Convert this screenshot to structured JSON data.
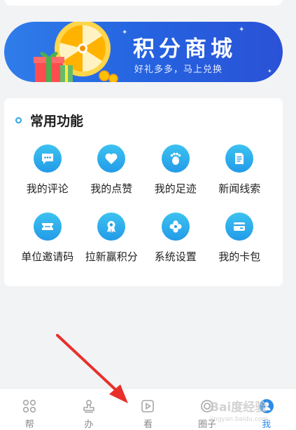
{
  "banner": {
    "title": "积分商城",
    "subtitle": "好礼多多，马上兑换"
  },
  "functions": {
    "title": "常用功能",
    "rows": [
      [
        {
          "label": "我的评论",
          "icon": "comment-icon"
        },
        {
          "label": "我的点赞",
          "icon": "heart-icon"
        },
        {
          "label": "我的足迹",
          "icon": "footprint-icon"
        },
        {
          "label": "新闻线索",
          "icon": "document-icon"
        }
      ],
      [
        {
          "label": "单位邀请码",
          "icon": "ticket-icon"
        },
        {
          "label": "拉新赢积分",
          "icon": "award-icon"
        },
        {
          "label": "系统设置",
          "icon": "settings-icon"
        },
        {
          "label": "我的卡包",
          "icon": "card-wallet-icon"
        }
      ]
    ]
  },
  "bottom_nav": [
    {
      "label": "帮",
      "icon": "grid-icon",
      "active": false
    },
    {
      "label": "办",
      "icon": "stamp-icon",
      "active": false
    },
    {
      "label": "看",
      "icon": "play-icon",
      "active": false
    },
    {
      "label": "圈子",
      "icon": "circle-icon",
      "active": false
    },
    {
      "label": "我",
      "icon": "profile-icon",
      "active": true
    }
  ],
  "watermark": {
    "brand": "Bai度经验",
    "url": "jingyan.baidu.com"
  },
  "colors": {
    "accent": "#2ba6e8",
    "banner": "#2563e0",
    "arrow": "#e8302b"
  }
}
